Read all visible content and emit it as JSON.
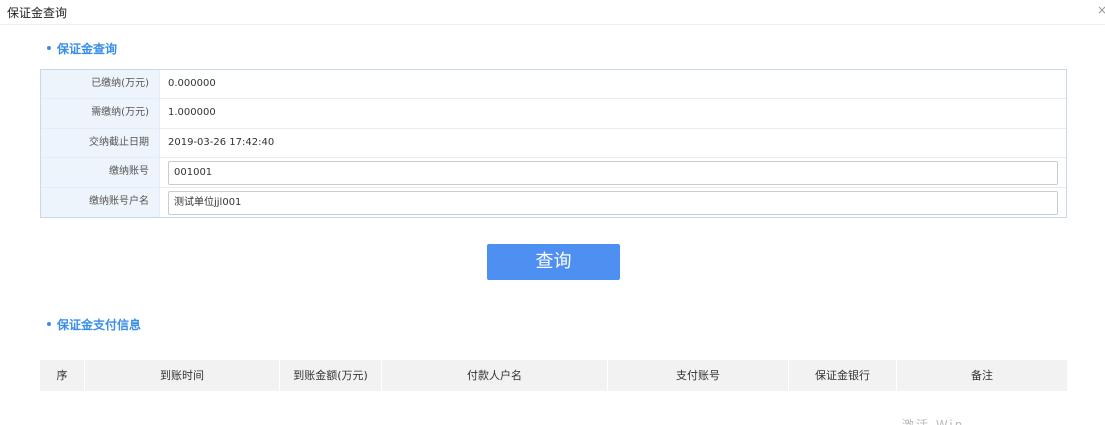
{
  "window": {
    "title": "保证金查询",
    "close": "×"
  },
  "query_section": {
    "title": "保证金查询",
    "rows": [
      {
        "label": "已缴纳(万元)",
        "value": "0.000000"
      },
      {
        "label": "需缴纳(万元)",
        "value": "1.000000"
      },
      {
        "label": "交纳截止日期",
        "value": "2019-03-26 17:42:40"
      },
      {
        "label": "缴纳账号",
        "value": "001001"
      },
      {
        "label": "缴纳账号户名",
        "value": "测试单位jjl001"
      }
    ],
    "query_button": "查询"
  },
  "payment_section": {
    "title": "保证金支付信息",
    "columns": [
      "序",
      "到账时间",
      "到账金额(万元)",
      "付款人户名",
      "支付账号",
      "保证金银行",
      "备注"
    ]
  },
  "footer_cutoff_text": "激活 Win"
}
